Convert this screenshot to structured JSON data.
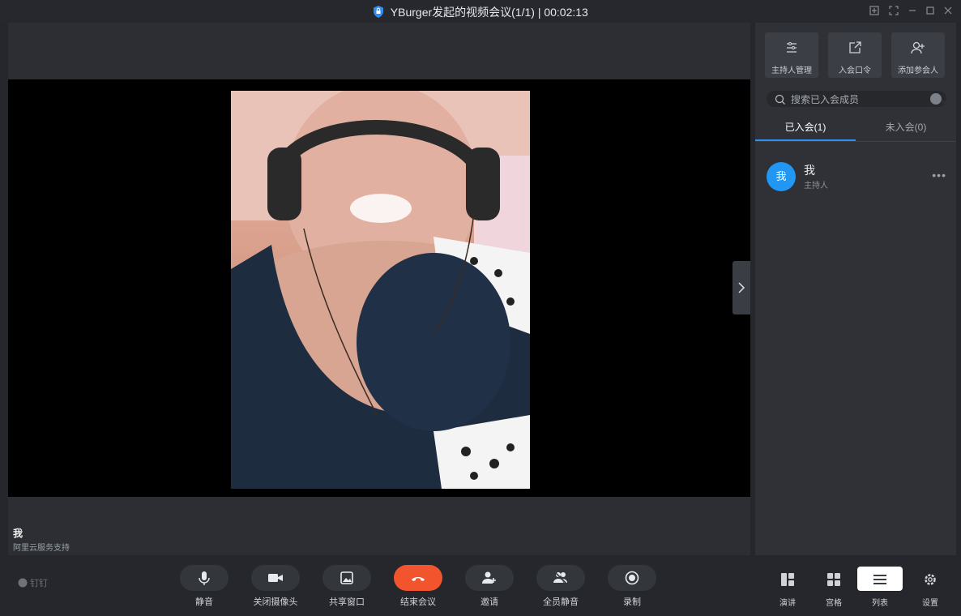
{
  "window": {
    "title": "YBurger发起的视频会议(1/1) | 00:02:13"
  },
  "stage": {
    "participant_name": "我",
    "participant_sub": "阿里云服务支持"
  },
  "sidebar": {
    "actions": [
      {
        "label": "主持人管理",
        "icon": "host-manage-icon"
      },
      {
        "label": "入会口令",
        "icon": "share-link-icon"
      },
      {
        "label": "添加参会人",
        "icon": "add-person-icon"
      }
    ],
    "search": {
      "placeholder": "搜索已入会成员"
    },
    "tabs": [
      {
        "label": "已入会(1)",
        "active": true
      },
      {
        "label": "未入会(0)",
        "active": false
      }
    ],
    "members": [
      {
        "avatar_text": "我",
        "name": "我",
        "role": "主持人"
      }
    ]
  },
  "toolbar": {
    "logo_text": "钉钉",
    "buttons": [
      {
        "label": "静音",
        "icon": "microphone-icon"
      },
      {
        "label": "关闭摄像头",
        "icon": "camera-icon"
      },
      {
        "label": "共享窗口",
        "icon": "share-screen-icon"
      },
      {
        "label": "结束会议",
        "icon": "end-call-icon"
      },
      {
        "label": "邀请",
        "icon": "invite-icon"
      },
      {
        "label": "全员静音",
        "icon": "mute-all-icon"
      },
      {
        "label": "录制",
        "icon": "record-icon"
      }
    ],
    "views": [
      {
        "label": "演讲",
        "icon": "speaker-view-icon",
        "selected": false
      },
      {
        "label": "宫格",
        "icon": "grid-view-icon",
        "selected": false
      },
      {
        "label": "列表",
        "icon": "list-view-icon",
        "selected": true
      },
      {
        "label": "设置",
        "icon": "settings-icon",
        "selected": false
      }
    ]
  },
  "colors": {
    "accent": "#2f8ff0",
    "end_call": "#f2542d",
    "avatar": "#2196f3",
    "background": "#25272c",
    "video_background": "#000000"
  }
}
